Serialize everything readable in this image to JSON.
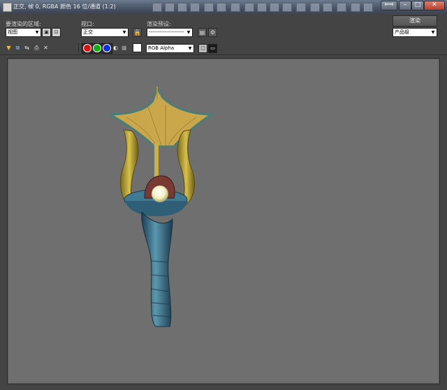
{
  "window": {
    "title": "正交, 帧 0, RGBA 颜色 16 位/通道 (1:2)"
  },
  "area_to_render": {
    "label": "要渲染的区域:",
    "value": "视图"
  },
  "viewport_section": {
    "label": "视口:",
    "value": "正交"
  },
  "render_preset": {
    "label": "渲染预设:",
    "value": "--------------------"
  },
  "render_button": {
    "label": "渲染"
  },
  "production_mode": {
    "value": "产品级"
  },
  "channel_display": {
    "value": "RGB Alpha"
  },
  "channels": {
    "red": "#e01010",
    "green": "#10b010",
    "blue": "#1030e0"
  },
  "icons": [
    "save-image-icon",
    "copy-image-icon",
    "clone-window-icon",
    "print-icon",
    "clear-icon",
    "lock-icon",
    "edit-region-icon",
    "crop-region-icon",
    "environment-icon",
    "render-setup-icon",
    "mono-icon",
    "alpha-icon",
    "color-swatch-icon"
  ],
  "scene": {
    "object": "ornate scepter 3d model"
  }
}
